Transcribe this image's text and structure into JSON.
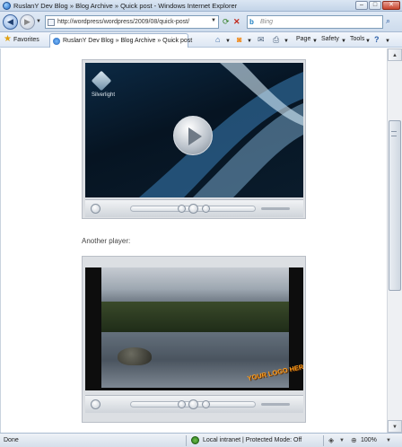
{
  "window": {
    "title": "RuslanY Dev Blog » Blog Archive » Quick post - Windows Internet Explorer",
    "minimize": "–",
    "maximize": "□",
    "close": "✕"
  },
  "address_bar": {
    "back_icon": "back-arrow-icon",
    "forward_icon": "forward-arrow-icon",
    "url": "http://wordpress/wordpress/2009/08/quick-post/",
    "search_placeholder": "Bing"
  },
  "command_bar": {
    "favorites_label": "Favorites",
    "tab_label": "RuslanY Dev Blog » Blog Archive » Quick post",
    "page_label": "Page",
    "safety_label": "Safety",
    "tools_label": "Tools"
  },
  "content": {
    "player1_logo_text": "Silverlight",
    "caption": "Another player:",
    "player2_logo_text": "YOUR LOGO HERE"
  },
  "status_bar": {
    "done": "Done",
    "zone": "Local intranet | Protected Mode: Off",
    "zoom": "100%"
  },
  "colors": {
    "chrome_blue": "#c3d4e8",
    "link_blue": "#1d5fb5",
    "logo_orange": "#ff9c1a"
  }
}
